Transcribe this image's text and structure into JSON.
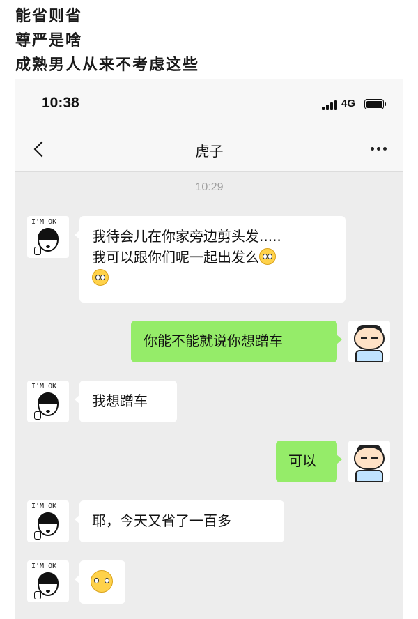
{
  "caption": {
    "line1": "能省则省",
    "line2": "尊严是啥",
    "line3": "成熟男人从来不考虑这些"
  },
  "status_bar": {
    "time": "10:38",
    "network": "4G"
  },
  "nav": {
    "title": "虎子"
  },
  "chat": {
    "timestamp": "10:29",
    "messages": [
      {
        "side": "left",
        "line1": "我待会儿在你家旁边剪头发.....",
        "line2": "我可以跟你们呢一起出发么",
        "emoji": "flushed-face"
      },
      {
        "side": "right",
        "text": "你能不能就说你想蹭车"
      },
      {
        "side": "left",
        "text": "我想蹭车"
      },
      {
        "side": "right",
        "text": "可以"
      },
      {
        "side": "left",
        "text": "耶，今天又省了一百多"
      },
      {
        "side": "left",
        "emoji": "thinking-face"
      }
    ]
  },
  "avatars": {
    "contact": {
      "text": "I'M OK"
    },
    "me": {
      "icon": "cartoon-boy-avatar"
    }
  },
  "colors": {
    "chat_bg": "#ededed",
    "my_bubble": "#95ec69",
    "their_bubble": "#ffffff"
  }
}
